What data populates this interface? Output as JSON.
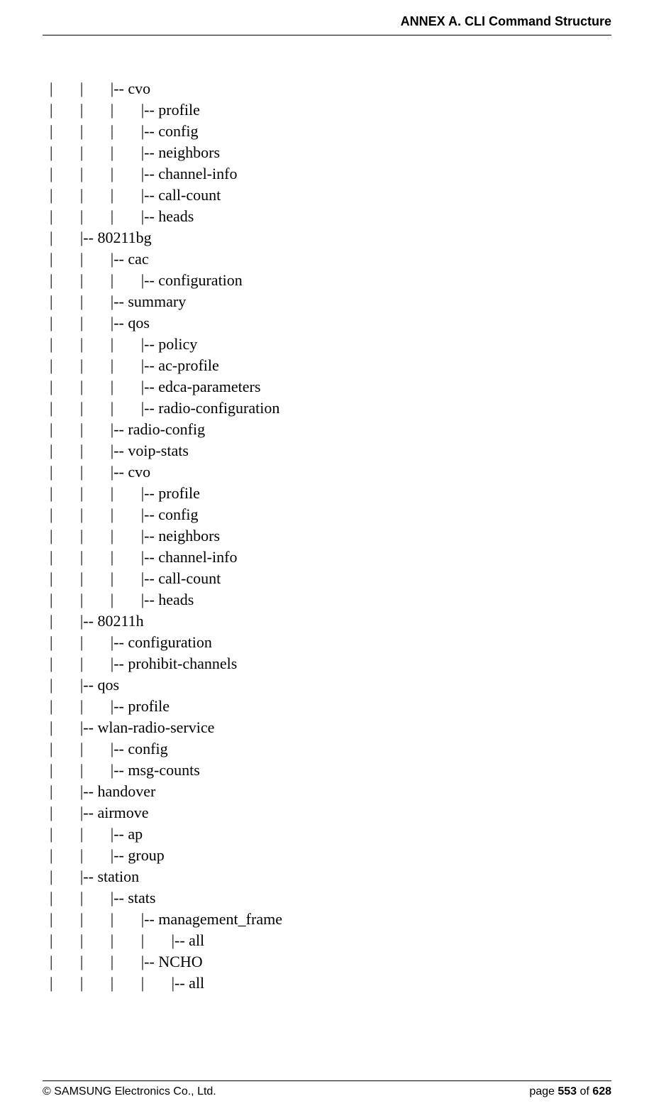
{
  "header": "ANNEX A. CLI Command Structure",
  "footer": {
    "left": "© SAMSUNG Electronics Co., Ltd.",
    "right_prefix": "page ",
    "right_page": "553",
    "right_sep": " of ",
    "right_total": "628"
  },
  "tree_lines": [
    "|       |       |-- cvo",
    "|       |       |       |-- profile",
    "|       |       |       |-- config",
    "|       |       |       |-- neighbors",
    "|       |       |       |-- channel-info",
    "|       |       |       |-- call-count",
    "|       |       |       |-- heads",
    "|       |-- 80211bg",
    "|       |       |-- cac",
    "|       |       |       |-- configuration",
    "|       |       |-- summary",
    "|       |       |-- qos",
    "|       |       |       |-- policy",
    "|       |       |       |-- ac-profile",
    "|       |       |       |-- edca-parameters",
    "|       |       |       |-- radio-configuration",
    "|       |       |-- radio-config",
    "|       |       |-- voip-stats",
    "|       |       |-- cvo",
    "|       |       |       |-- profile",
    "|       |       |       |-- config",
    "|       |       |       |-- neighbors",
    "|       |       |       |-- channel-info",
    "|       |       |       |-- call-count",
    "|       |       |       |-- heads",
    "|       |-- 80211h",
    "|       |       |-- configuration",
    "|       |       |-- prohibit-channels",
    "|       |-- qos",
    "|       |       |-- profile",
    "|       |-- wlan-radio-service",
    "|       |       |-- config",
    "|       |       |-- msg-counts",
    "|       |-- handover",
    "|       |-- airmove",
    "|       |       |-- ap",
    "|       |       |-- group",
    "|       |-- station",
    "|       |       |-- stats",
    "|       |       |       |-- management_frame",
    "|       |       |       |       |-- all",
    "|       |       |       |-- NCHO",
    "|       |       |       |       |-- all"
  ]
}
